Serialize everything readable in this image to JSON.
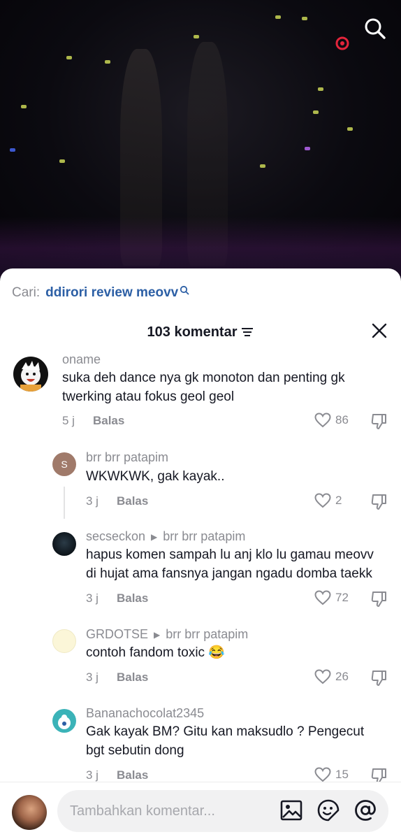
{
  "search_bar": {
    "prefix": "Cari:",
    "query": "ddirori review meovv"
  },
  "comments_header": {
    "title": "103 komentar"
  },
  "comments": [
    {
      "username": "oname",
      "reply_to": "",
      "text": [
        "suka deh dance nya gk monoton dan penting gk",
        "twerking atau fokus geol geol"
      ],
      "time": "5 j",
      "reply_label": "Balas",
      "likes": "86"
    },
    {
      "username": "brr brr patapim",
      "reply_to": "",
      "avatar_letter": "S",
      "text": [
        "WKWKWK, gak kayak.."
      ],
      "time": "3 j",
      "reply_label": "Balas",
      "likes": "2"
    },
    {
      "username": "secseckon",
      "reply_to": "brr brr patapim",
      "text": [
        "hapus komen sampah lu anj klo lu gamau meovv",
        "di hujat ama fansnya jangan ngadu domba taekk"
      ],
      "time": "3 j",
      "reply_label": "Balas",
      "likes": "72"
    },
    {
      "username": "GRDOTSE",
      "reply_to": "brr brr patapim",
      "text": [
        "contoh fandom toxic 😂"
      ],
      "time": "3 j",
      "reply_label": "Balas",
      "likes": "26"
    },
    {
      "username": "Bananachocolat2345",
      "reply_to": "",
      "text": [
        "Gak kayak BM? Gitu kan maksudlo ? Pengecut",
        "bgt sebutin dong"
      ],
      "time": "3 j",
      "reply_label": "Balas",
      "likes": "15"
    }
  ],
  "comment_input": {
    "placeholder": "Tambahkan komentar..."
  },
  "colors": {
    "link_blue": "#2c5fa5",
    "muted": "#8a8b91",
    "text": "#161823",
    "record_red": "#e3243b"
  },
  "icons": [
    "search-icon",
    "record-icon",
    "magnifier-small-icon",
    "sort-icon",
    "close-icon",
    "heart-icon",
    "dislike-icon",
    "image-icon",
    "emoji-icon",
    "mention-icon"
  ]
}
